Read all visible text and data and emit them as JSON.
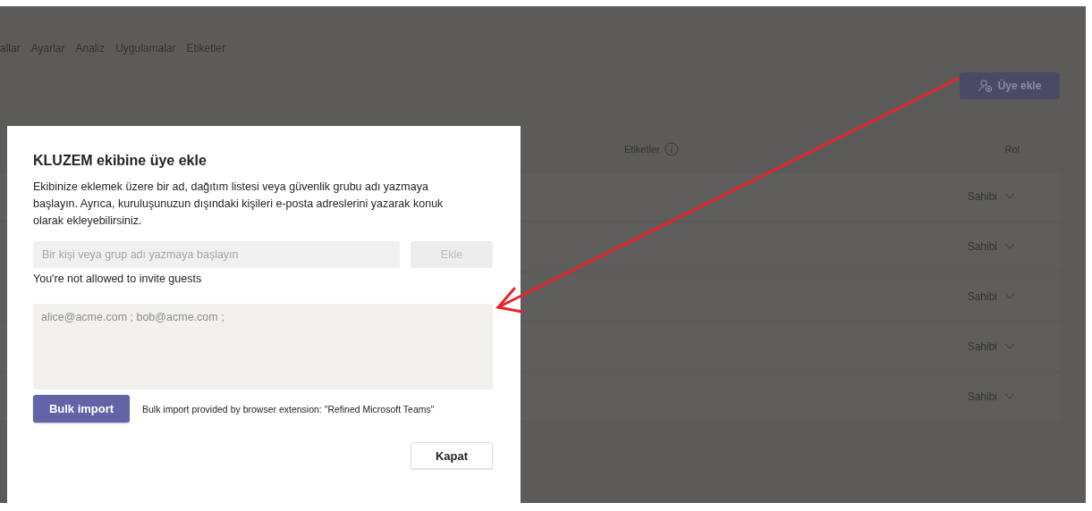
{
  "nav_tabs": [
    {
      "label": "allar"
    },
    {
      "label": "Ayarlar"
    },
    {
      "label": "Analiz"
    },
    {
      "label": "Uygulamalar"
    },
    {
      "label": "Etiketler"
    }
  ],
  "add_member_button": {
    "label": "Üye ekle"
  },
  "table": {
    "columns": [
      {
        "label": "Etiketler",
        "info": true
      },
      {
        "label": "Rol",
        "info": false
      }
    ],
    "rows": [
      {
        "role": "Sahibi"
      },
      {
        "role": "Sahibi"
      },
      {
        "role": "Sahibi"
      },
      {
        "role": "Sahibi"
      },
      {
        "role": "Sahibi"
      }
    ]
  },
  "dialog": {
    "title": "KLUZEM ekibine üye ekle",
    "description": "Ekibinize eklemek üzere bir ad, dağıtım listesi veya güvenlik grubu adı yazmaya başlayın. Ayrıca, kuruluşunuzun dışındaki kişileri e-posta adreslerini yazarak konuk olarak ekleyebilirsiniz.",
    "search": {
      "placeholder": "Bir kişi veya grup adı yazmaya başlayın"
    },
    "add_button": {
      "label": "Ekle",
      "disabled": true
    },
    "error": "You're not allowed to invite guests",
    "bulk_field": {
      "placeholder": "alice@acme.com ; bob@acme.com ;"
    },
    "bulk_button": {
      "label": "Bulk import"
    },
    "bulk_note": "Bulk import provided by browser extension: \"Refined Microsoft Teams\"",
    "close_button": {
      "label": "Kapat"
    }
  }
}
